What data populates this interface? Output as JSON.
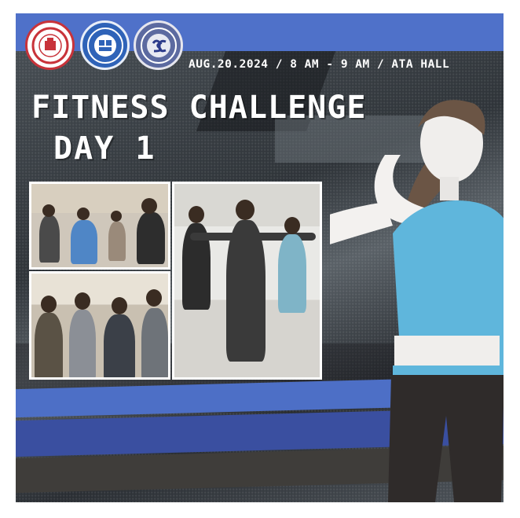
{
  "poster": {
    "event_info": "AUG.20.2024 / 8 AM - 9 AM / ATA HALL",
    "title_line1": "FITNESS CHALLENGE",
    "title_line2": "DAY 1"
  },
  "logos": [
    {
      "name": "university-seal",
      "color": "#c8333a",
      "text": "SILLIMAN UNIVERSITY"
    },
    {
      "name": "college-seal",
      "color": "#2f63b8",
      "text": "SILLIMAN UNIVERSITY"
    },
    {
      "name": "council-seal",
      "color": "#5c6aa0",
      "text": "SC"
    }
  ],
  "photos": [
    {
      "name": "group-exercise-circle-photo"
    },
    {
      "name": "students-group-photo"
    },
    {
      "name": "instructor-stretch-photo"
    }
  ],
  "colors": {
    "accent_blue": "#4f71c9",
    "deep_blue": "#3a4fa0",
    "background_gray": "#2f3439",
    "character_top": "#5fb6dc"
  }
}
